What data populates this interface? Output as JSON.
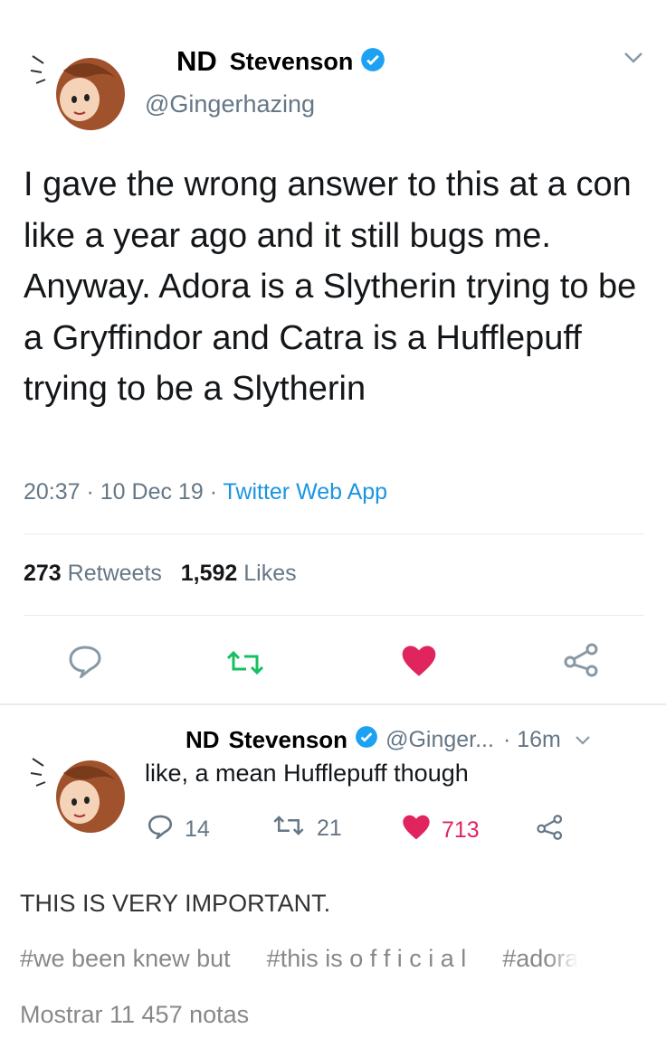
{
  "tweet": {
    "display_name_prefix": "ND",
    "display_name": "Stevenson",
    "handle": "@Gingerhazing",
    "text": "I gave the wrong answer to this at a con like a year ago and it still bugs me. Anyway. Adora is a Slytherin trying to be a Gryffindor and Catra is a Hufflepuff trying to be a Slytherin",
    "time": "20:37 · 10 Dec 19 · ",
    "source": "Twitter Web App",
    "retweets_count": "273",
    "retweets_label": "Retweets",
    "likes_count": "1,592",
    "likes_label": "Likes",
    "colors": {
      "accent": "#1da1f2",
      "retweet": "#17bf63",
      "like": "#e0245e",
      "muted": "#657786"
    }
  },
  "reply": {
    "display_name_prefix": "ND",
    "display_name": "Stevenson",
    "handle": "@Ginger...",
    "time": "· 16m",
    "text": "like, a mean Hufflepuff though",
    "replies": "14",
    "retweets": "21",
    "likes": "713"
  },
  "post": {
    "comment": "THIS IS VERY IMPORTANT.",
    "tags": [
      "#we been knew but",
      "#this is o f f i c i a l",
      "#adora"
    ],
    "notes": "Mostrar 11 457 notas"
  },
  "icons": [
    "avatar",
    "verified-badge-icon",
    "chevron-down-icon",
    "reply-icon",
    "retweet-icon",
    "heart-icon",
    "share-icon"
  ]
}
